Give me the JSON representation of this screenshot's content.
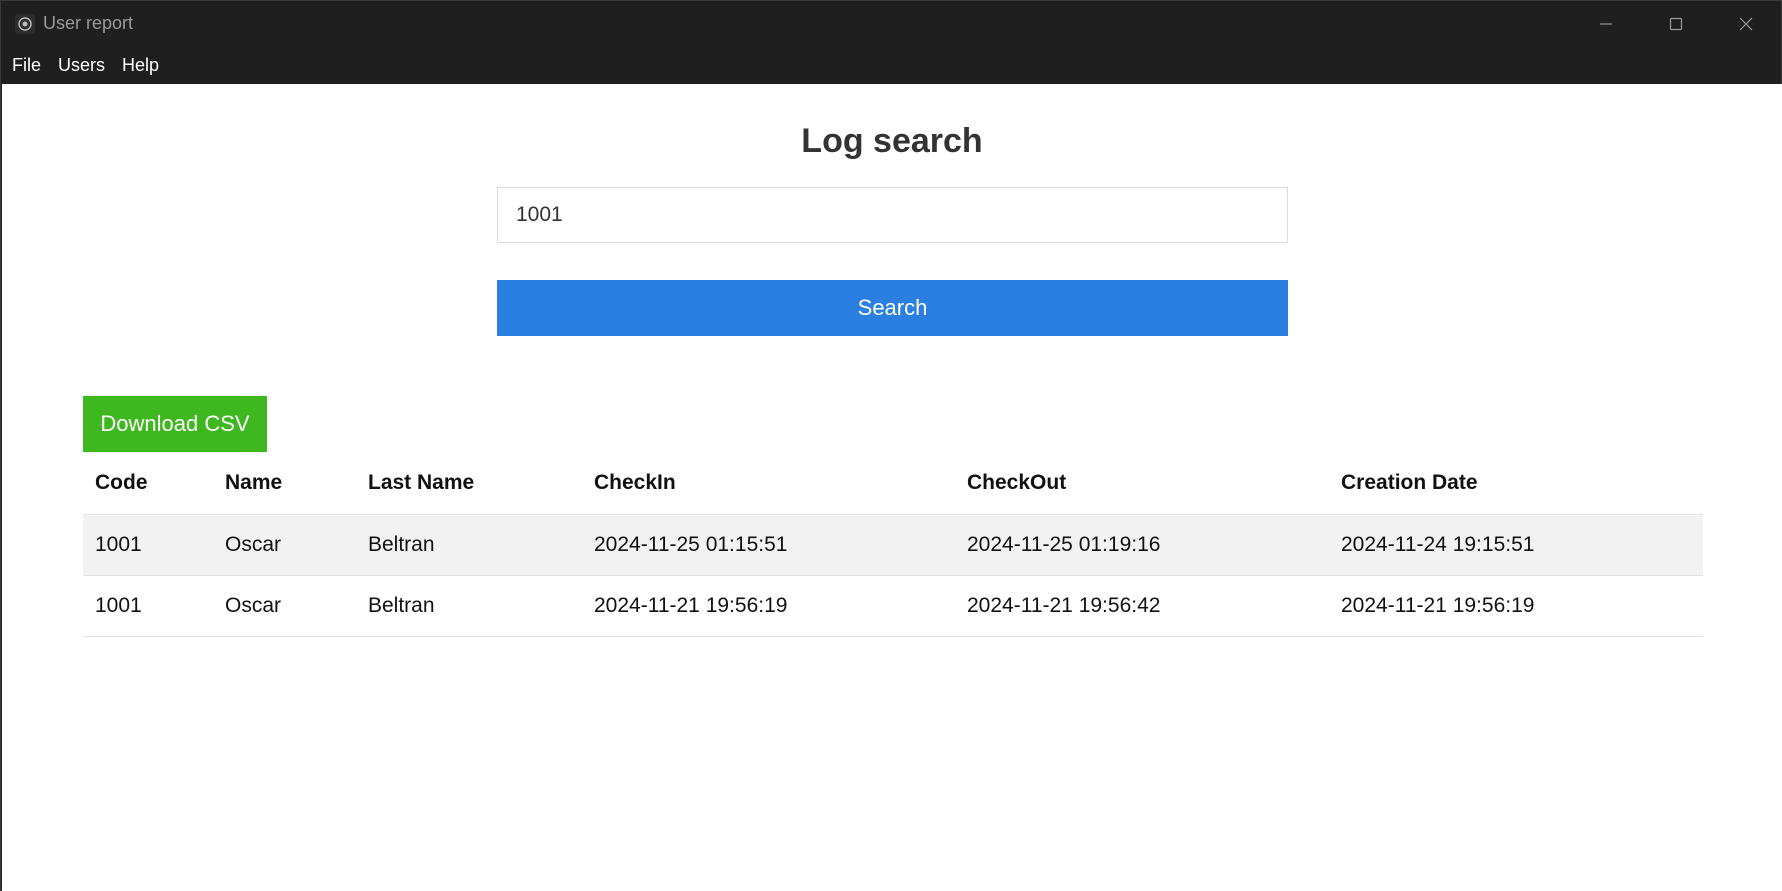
{
  "window": {
    "title": "User report"
  },
  "menu": {
    "items": [
      "File",
      "Users",
      "Help"
    ]
  },
  "main": {
    "heading": "Log search",
    "search_value": "1001",
    "search_button": "Search",
    "download_button": "Download CSV"
  },
  "table": {
    "headers": [
      "Code",
      "Name",
      "Last Name",
      "CheckIn",
      "CheckOut",
      "Creation Date"
    ],
    "rows": [
      [
        "1001",
        "Oscar",
        "Beltran",
        "2024-11-25 01:15:51",
        "2024-11-25 01:19:16",
        "2024-11-24 19:15:51"
      ],
      [
        "1001",
        "Oscar",
        "Beltran",
        "2024-11-21 19:56:19",
        "2024-11-21 19:56:42",
        "2024-11-21 19:56:19"
      ]
    ]
  },
  "colors": {
    "titlebar": "#1f1f1f",
    "primary_button": "#2b7fe0",
    "success_button": "#3fb81f",
    "striped_row": "#f2f2f2"
  },
  "icons": {
    "app": "app-logo-icon",
    "minimize": "minimize-icon",
    "maximize": "maximize-icon",
    "close": "close-icon"
  }
}
